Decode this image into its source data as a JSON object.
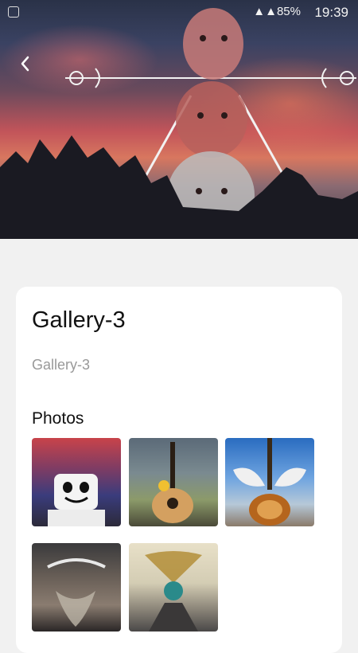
{
  "status_bar": {
    "time": "19:39",
    "battery": "85%"
  },
  "gallery": {
    "title": "Gallery-3",
    "subtitle": "Gallery-3",
    "photos_heading": "Photos"
  },
  "icons": {
    "back": "chevron-left-icon",
    "instagram": "instagram-icon",
    "signal": "signal-icon",
    "battery": "battery-icon"
  }
}
